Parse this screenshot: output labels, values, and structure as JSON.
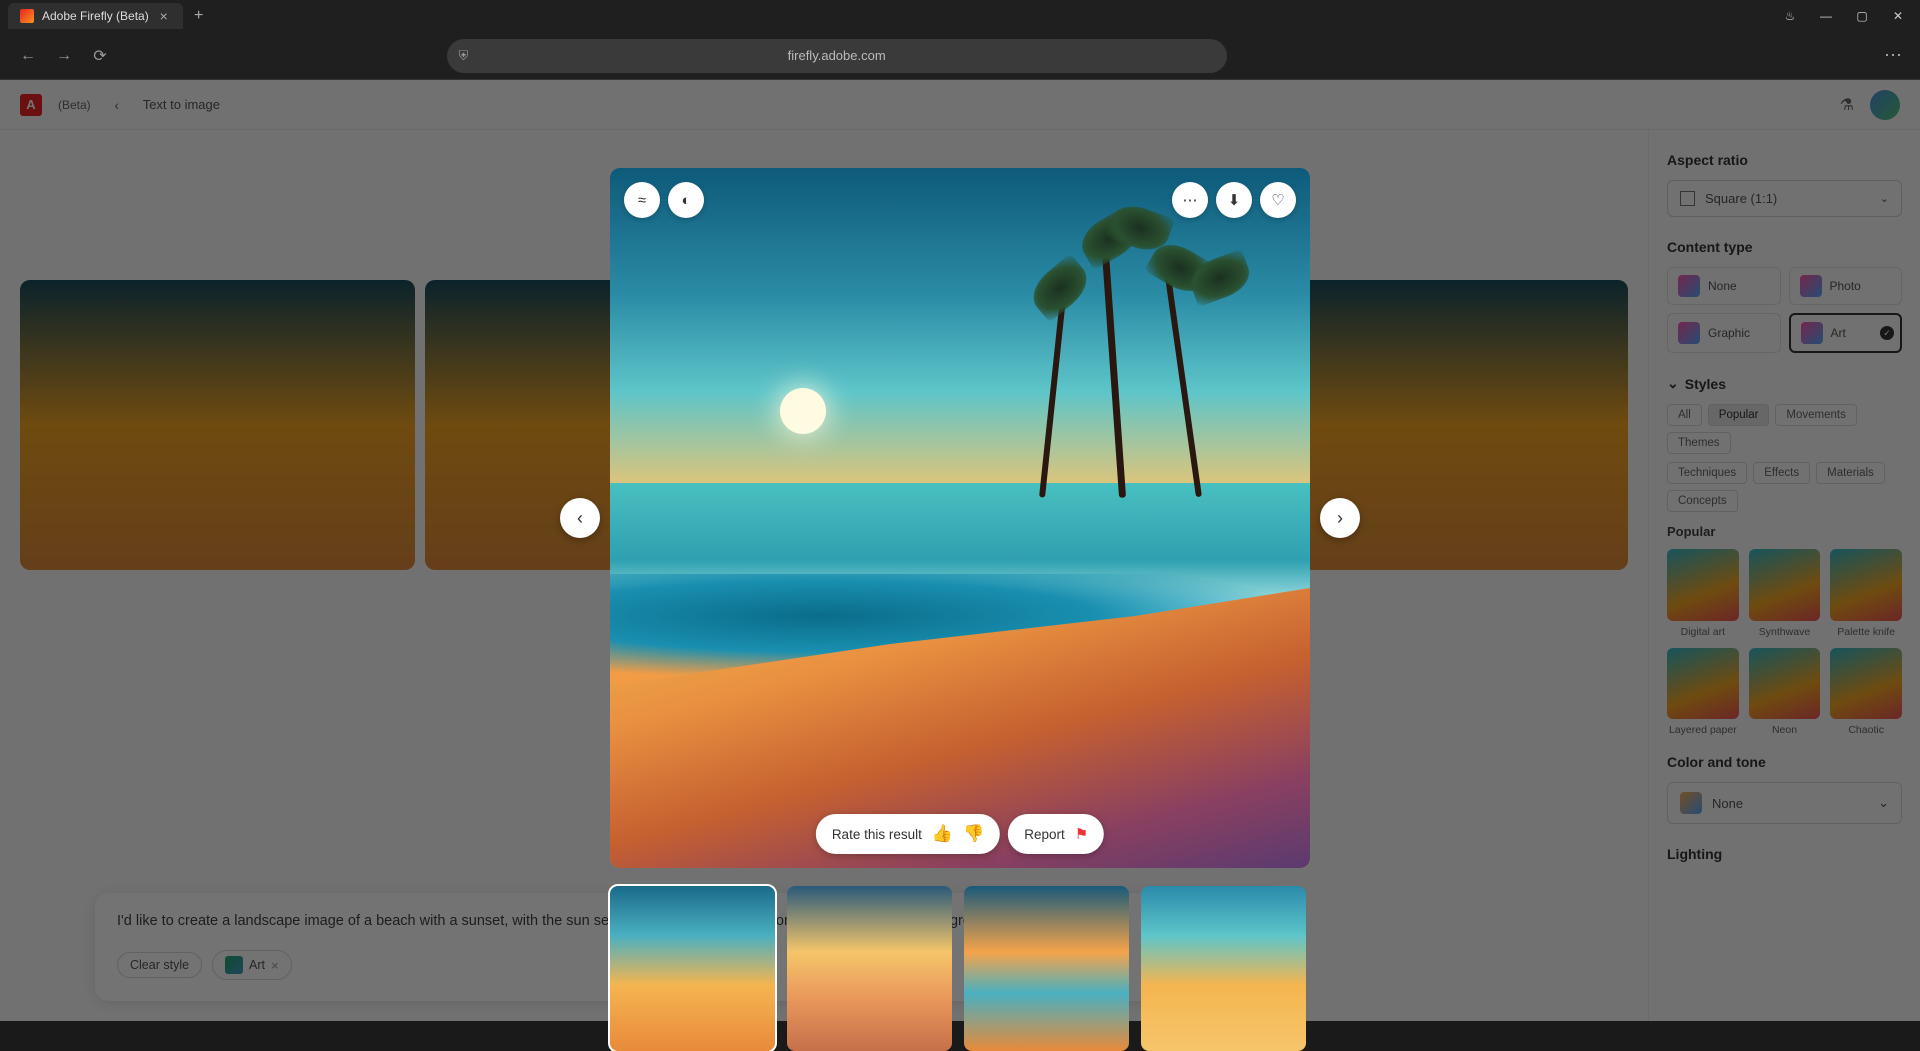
{
  "browser": {
    "tab_title": "Adobe Firefly (Beta)",
    "url": "firefly.adobe.com"
  },
  "app_header": {
    "beta": "(Beta)",
    "breadcrumb": "Text to image"
  },
  "prompt": {
    "text": "I'd like to create a landscape image of a beach with a sunset, with the sun setting over the ocean and some palm trees in the background.",
    "clear_style": "Clear style",
    "art_chip": "Art",
    "refresh": "Refresh"
  },
  "sidebar": {
    "aspect_ratio": {
      "title": "Aspect ratio",
      "value": "Square (1:1)"
    },
    "content_type": {
      "title": "Content type",
      "items": [
        "None",
        "Photo",
        "Graphic",
        "Art"
      ],
      "selected": "Art"
    },
    "styles": {
      "title": "Styles",
      "tabs": [
        "All",
        "Popular",
        "Movements",
        "Themes",
        "Techniques",
        "Effects",
        "Materials",
        "Concepts"
      ],
      "active_tab": "Popular",
      "popular_title": "Popular",
      "items": [
        "Digital art",
        "Synthwave",
        "Palette knife",
        "Layered paper",
        "Neon",
        "Chaotic"
      ]
    },
    "color_tone": {
      "title": "Color and tone",
      "value": "None"
    },
    "lighting": {
      "title": "Lighting"
    }
  },
  "lightbox": {
    "rate_label": "Rate this result",
    "report_label": "Report"
  }
}
